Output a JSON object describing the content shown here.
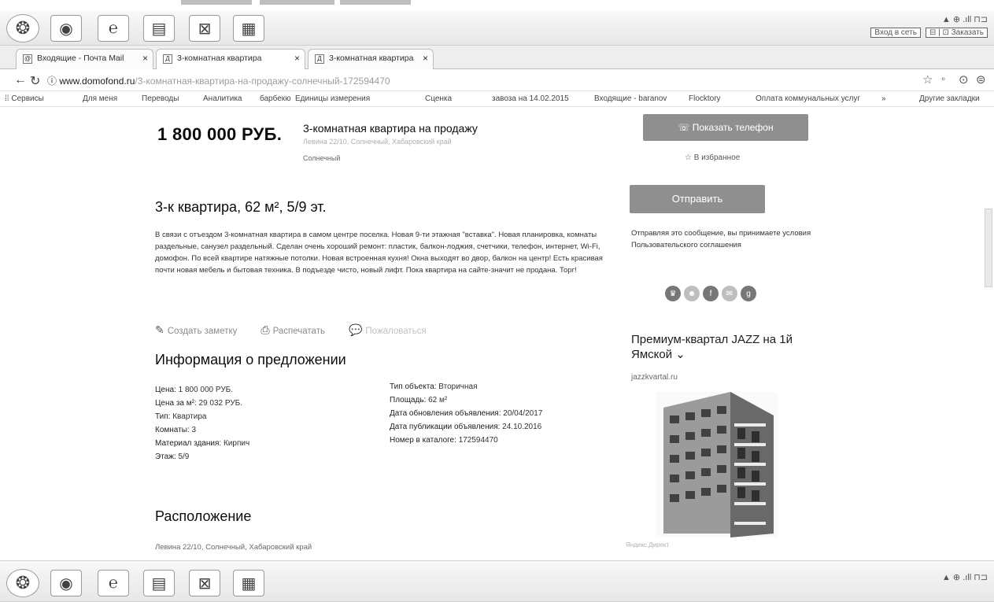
{
  "browser": {
    "tabs": [
      {
        "label": "Входящие - Почта Mail",
        "close": "×"
      },
      {
        "label": "3-комнатная квартира",
        "close": "×"
      },
      {
        "label": "3-комнатная квартира",
        "close": "×"
      }
    ],
    "url_host": "www.domofond.ru",
    "url_rest": "/3-комнатная-квартира-на-продажу-солнечный-172594470",
    "bookmarks": [
      "Сервисы",
      "Для меня",
      "Переводы",
      "Аналитика",
      "барбекю",
      "Единицы измерения",
      "Сценка",
      "завоза на 14.02.2015",
      "Входящие - baranov",
      "Flocktory",
      "Оплата коммунальных услуг",
      "»",
      "Другие закладки"
    ]
  },
  "tray": {
    "status": "▲ ⊕ .ıll ⊓⊐",
    "btn1": "Вход в сеть",
    "btn2": "⊟ | ⊡ Заказать"
  },
  "listing": {
    "price": "1 800 000 РУБ.",
    "title": "3-комнатная квартира на продажу",
    "address_faded": "Левина 22/10, Солнечный, Хабаровский край",
    "city": "Солнечный",
    "heading": "3-к квартира, 62 м², 5/9 эт.",
    "description": "В связи с отъездом 3-комнатная квартира в самом центре поселка. Новая 9-ти этажная \"вставка\". Новая планировка, комнаты раздельные, санузел раздельный. Сделан очень хороший ремонт: пластик, балкон-лоджия, счетчики, телефон, интернет, Wi-Fi, домофон. По всей квартире натяжные потолки. Новая встроенная кухня! Окна выходят во двор, балкон на центр! Есть красивая почти новая мебель и бытовая техника. В подъезде чисто, новый лифт. Пока квартира на сайте-значит не продана. Торг!",
    "actions": {
      "note": "Создать заметку",
      "print": "Распечатать",
      "complain": "Пожаловаться"
    }
  },
  "info": {
    "heading": "Информация о предложении",
    "left": [
      {
        "k": "Цена:",
        "v": "1 800 000 РУБ."
      },
      {
        "k": "Цена за м²:",
        "v": "29 032 РУБ."
      },
      {
        "k": "Тип:",
        "v": "Квартира"
      },
      {
        "k": "Комнаты:",
        "v": "3"
      },
      {
        "k": "Материал здания:",
        "v": "Кирпич"
      },
      {
        "k": "Этаж:",
        "v": "5/9"
      }
    ],
    "right": [
      {
        "k": "Тип объекта:",
        "v": "Вторичная"
      },
      {
        "k": "Площадь:",
        "v": "62 м²"
      },
      {
        "k": "Дата обновления объявления:",
        "v": "20/04/2017"
      },
      {
        "k": "Дата публикации объявления:",
        "v": "24.10.2016"
      },
      {
        "k": "Номер в каталоге:",
        "v": "172594470"
      }
    ]
  },
  "location": {
    "heading": "Расположение",
    "address": "Левина 22/10, Солнечный, Хабаровский край"
  },
  "sidebar": {
    "show_phone": "☏ Показать телефон",
    "favorite": "☆ В избранное",
    "send": "Отправить",
    "agree": "Отправляя это сообщение, вы принимаете условия Пользовательского соглашения",
    "social": [
      "♛",
      "☻",
      "f",
      "✉",
      "g"
    ],
    "ad_title": "Премиум-квартал JAZZ на 1й Ямской ⌄",
    "ad_domain": "jazzkvartal.ru",
    "ad_foot": "Яндекс.Директ"
  }
}
